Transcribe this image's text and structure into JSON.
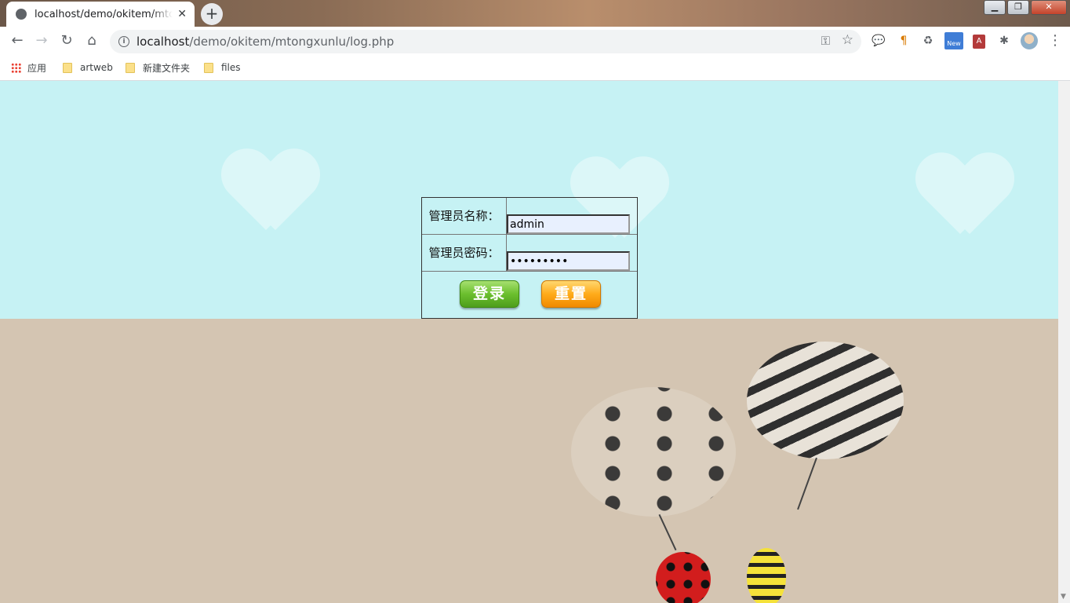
{
  "browser": {
    "tab_title": "localhost/demo/okitem/mtongxunlu/log.php",
    "url_host": "localhost",
    "url_path": "/demo/okitem/mtongxunlu/log.php",
    "new_tab_symbol": "+",
    "tab_close_symbol": "✕",
    "window_buttons": [
      "▁",
      "❐",
      "✕"
    ],
    "extension_badge": "New",
    "pdf_badge": "A"
  },
  "bookmarks": [
    {
      "label": "应用",
      "icon": "apps-icon"
    },
    {
      "label": "artweb",
      "icon": "folder-icon"
    },
    {
      "label": "新建文件夹",
      "icon": "folder-icon"
    },
    {
      "label": "files",
      "icon": "folder-icon"
    }
  ],
  "login": {
    "username_label": "管理员名称：",
    "username_value": "admin",
    "password_label": "管理员密码：",
    "password_value": "123456789",
    "login_button": "登录",
    "reset_button": "重置"
  },
  "colors": {
    "sky": "#c6f2f4",
    "ground": "#d4c5b2",
    "login_green": "#6bbf2e",
    "reset_orange": "#ffab1a"
  }
}
